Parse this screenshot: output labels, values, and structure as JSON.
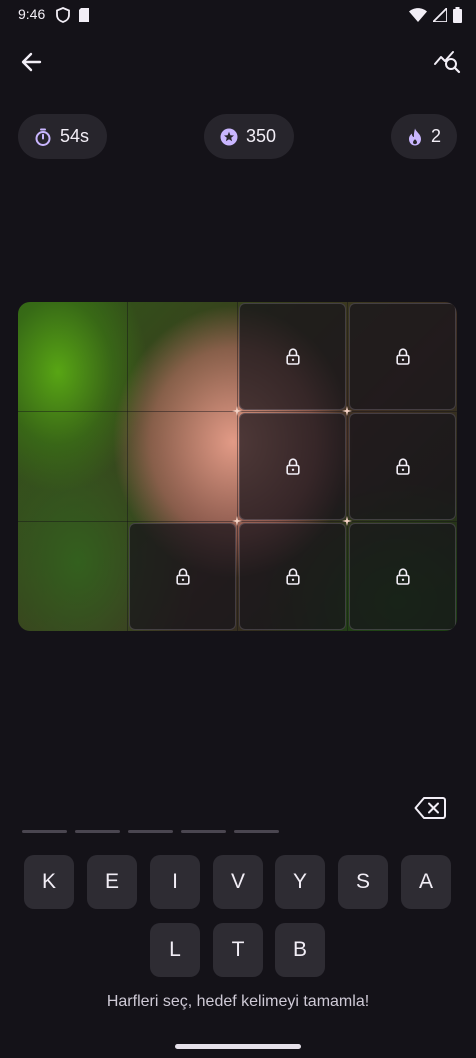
{
  "status_bar": {
    "time": "9:46",
    "left_icons": [
      "shield-icon",
      "sd-card-icon"
    ],
    "right_icons": [
      "wifi-icon",
      "signal-icon",
      "battery-icon"
    ]
  },
  "top_bar": {
    "back_icon": "arrow-left-icon",
    "action_icon": "analytics-search-icon"
  },
  "stats": {
    "timer": {
      "icon": "timer-icon",
      "value": "54s"
    },
    "score": {
      "icon": "star-badge-icon",
      "value": "350"
    },
    "streak": {
      "icon": "flame-icon",
      "value": "2"
    }
  },
  "puzzle": {
    "rows": 3,
    "cols": 4,
    "locked_tiles": [
      {
        "row": 0,
        "col": 2
      },
      {
        "row": 0,
        "col": 3
      },
      {
        "row": 1,
        "col": 2
      },
      {
        "row": 1,
        "col": 3
      },
      {
        "row": 2,
        "col": 1
      },
      {
        "row": 2,
        "col": 2
      },
      {
        "row": 2,
        "col": 3
      }
    ],
    "lock_icon": "lock-icon"
  },
  "answer": {
    "slot_count": 5,
    "delete_icon": "backspace-icon"
  },
  "keyboard": {
    "row1": [
      "K",
      "E",
      "I",
      "V",
      "Y",
      "S",
      "A"
    ],
    "row2": [
      "L",
      "T",
      "B"
    ]
  },
  "hint_text": "Harfleri seç, hedef kelimeyi tamamla!",
  "colors": {
    "background": "#141218",
    "chip": "#27252c",
    "key": "#2e2c33",
    "accent": "#c9b6ff"
  }
}
